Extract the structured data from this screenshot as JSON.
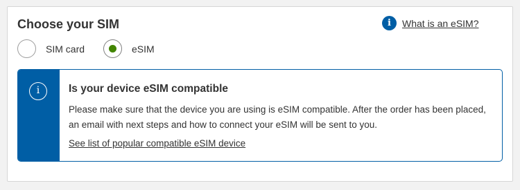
{
  "section": {
    "heading": "Choose your SIM",
    "help_link": "What is an eSIM?",
    "help_icon": "info-icon"
  },
  "options": [
    {
      "label": "SIM card",
      "selected": false
    },
    {
      "label": "eSIM",
      "selected": true
    }
  ],
  "notice": {
    "icon": "info-icon",
    "title": "Is your device eSIM compatible",
    "body": "Please make sure that the device you are using is eSIM compatible. After the order has been placed, an email with next steps and how to connect your eSIM will be sent to you.",
    "link": "See list of popular compatible eSIM device"
  },
  "colors": {
    "accent_blue": "#005ea5",
    "selected_green": "#428501",
    "text": "#333333"
  }
}
